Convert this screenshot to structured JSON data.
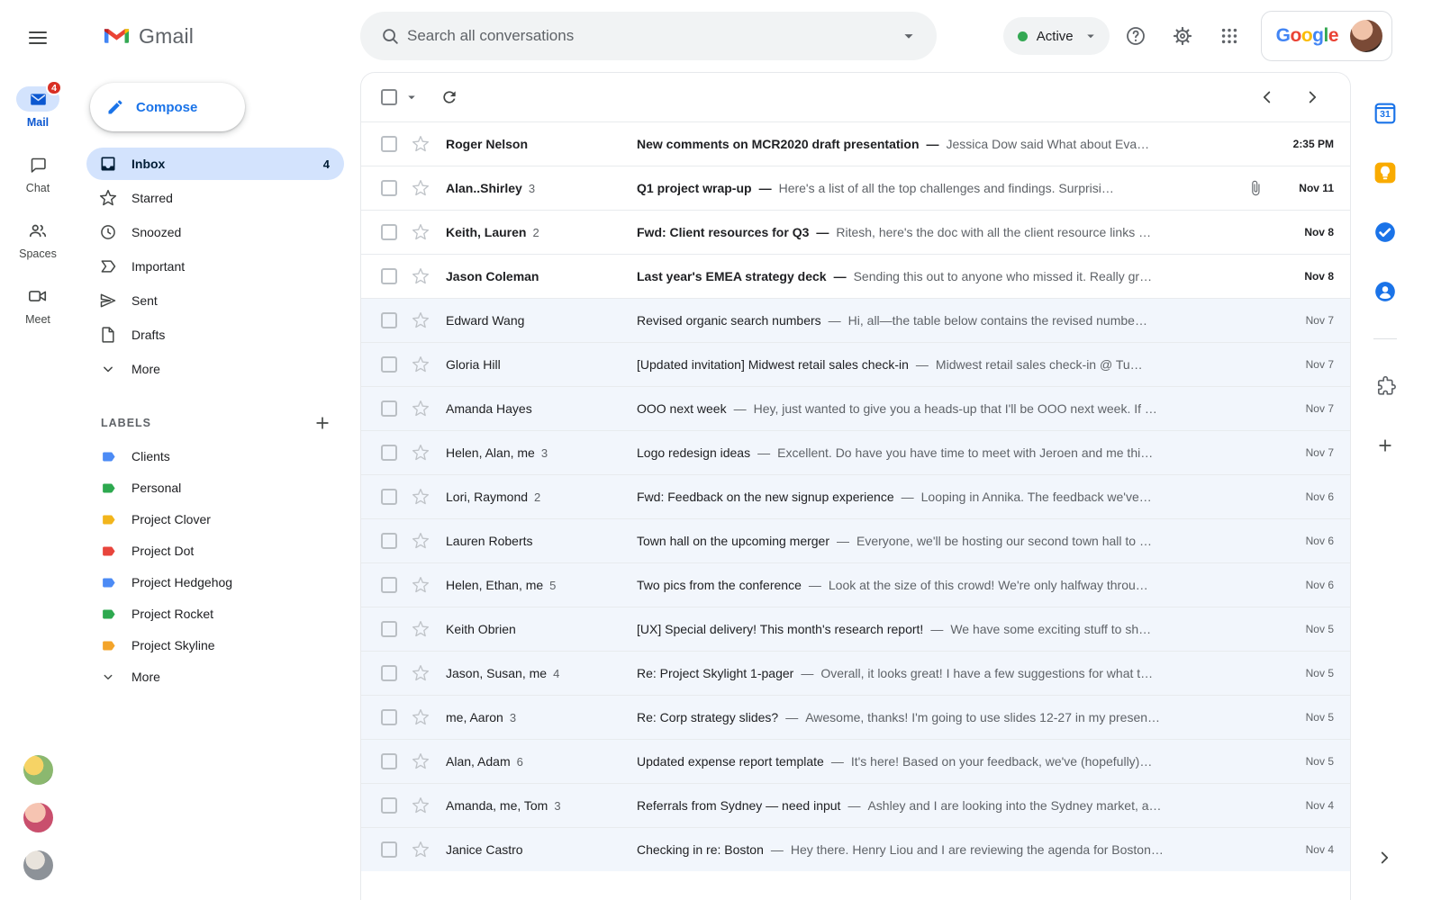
{
  "brand": {
    "name": "Gmail"
  },
  "colors": {
    "accent_blue": "#0b57d0",
    "selection_blue": "#d3e3fd",
    "status_green": "#34a853",
    "badge_red": "#d93025"
  },
  "left_rail": {
    "items": [
      {
        "label": "Mail",
        "icon": "mail",
        "badge": "4",
        "active": true
      },
      {
        "label": "Chat",
        "icon": "chat",
        "active": false
      },
      {
        "label": "Spaces",
        "icon": "spaces",
        "active": false
      },
      {
        "label": "Meet",
        "icon": "meet",
        "active": false
      }
    ],
    "avatars": [
      "workspace-avatar-1",
      "workspace-avatar-2",
      "workspace-avatar-3"
    ]
  },
  "header": {
    "search_placeholder": "Search all conversations",
    "status_label": "Active",
    "status_color": "#34a853",
    "google_letters": [
      {
        "ch": "G",
        "color": "#4285F4"
      },
      {
        "ch": "o",
        "color": "#EA4335"
      },
      {
        "ch": "o",
        "color": "#FBBC05"
      },
      {
        "ch": "g",
        "color": "#4285F4"
      },
      {
        "ch": "l",
        "color": "#34A853"
      },
      {
        "ch": "e",
        "color": "#EA4335"
      }
    ]
  },
  "sidebar": {
    "compose_label": "Compose",
    "items": [
      {
        "label": "Inbox",
        "icon": "inbox",
        "count": "4",
        "active": true
      },
      {
        "label": "Starred",
        "icon": "star-nav"
      },
      {
        "label": "Snoozed",
        "icon": "clock"
      },
      {
        "label": "Important",
        "icon": "important"
      },
      {
        "label": "Sent",
        "icon": "sent"
      },
      {
        "label": "Drafts",
        "icon": "draft"
      },
      {
        "label": "More",
        "icon": "chevron-down"
      }
    ],
    "labels_title": "LABELS",
    "labels": [
      {
        "label": "Clients",
        "color": "#4c8bf5"
      },
      {
        "label": "Personal",
        "color": "#2da94f"
      },
      {
        "label": "Project Clover",
        "color": "#f2b51c"
      },
      {
        "label": "Project Dot",
        "color": "#e8453c"
      },
      {
        "label": "Project Hedgehog",
        "color": "#4c8bf5"
      },
      {
        "label": "Project Rocket",
        "color": "#2da94f"
      },
      {
        "label": "Project Skyline",
        "color": "#f3a42a"
      },
      {
        "label": "More",
        "icon": "chevron-down"
      }
    ]
  },
  "list": {
    "separator": "—"
  },
  "emails": [
    {
      "sender": "Roger Nelson",
      "subject": "New comments on MCR2020 draft presentation",
      "snippet": "Jessica Dow said What about Eva…",
      "date": "2:35 PM",
      "unread": true
    },
    {
      "sender": "Alan..Shirley",
      "count": "3",
      "subject": "Q1 project wrap-up",
      "snippet": "Here's a list of all the top challenges and findings. Surprisi…",
      "date": "Nov 11",
      "unread": true,
      "attachment": true
    },
    {
      "sender": "Keith, Lauren",
      "count": "2",
      "subject": "Fwd: Client resources for Q3",
      "snippet": "Ritesh, here's the doc with all the client resource links …",
      "date": "Nov 8",
      "unread": true
    },
    {
      "sender": "Jason Coleman",
      "subject": "Last year's EMEA strategy deck",
      "snippet": "Sending this out to anyone who missed it. Really gr…",
      "date": "Nov 8",
      "unread": true
    },
    {
      "sender": "Edward Wang",
      "subject": "Revised organic search numbers",
      "snippet": "Hi, all—the table below contains the revised numbe…",
      "date": "Nov 7",
      "unread": false
    },
    {
      "sender": "Gloria Hill",
      "subject": "[Updated invitation] Midwest retail sales check-in",
      "snippet": "Midwest retail sales check-in @ Tu…",
      "date": "Nov 7",
      "unread": false
    },
    {
      "sender": "Amanda Hayes",
      "subject": "OOO next week",
      "snippet": "Hey, just wanted to give you a heads-up that I'll be OOO next week. If …",
      "date": "Nov 7",
      "unread": false
    },
    {
      "sender": "Helen, Alan, me",
      "count": "3",
      "subject": "Logo redesign ideas",
      "snippet": "Excellent. Do have you have time to meet with Jeroen and me thi…",
      "date": "Nov 7",
      "unread": false
    },
    {
      "sender": "Lori, Raymond",
      "count": "2",
      "subject": "Fwd: Feedback on the new signup experience",
      "snippet": "Looping in Annika. The feedback we've…",
      "date": "Nov 6",
      "unread": false
    },
    {
      "sender": "Lauren Roberts",
      "subject": "Town hall on the upcoming merger",
      "snippet": "Everyone, we'll be hosting our second town hall to …",
      "date": "Nov 6",
      "unread": false
    },
    {
      "sender": "Helen, Ethan, me",
      "count": "5",
      "subject": "Two pics from the conference",
      "snippet": "Look at the size of this crowd! We're only halfway throu…",
      "date": "Nov 6",
      "unread": false
    },
    {
      "sender": "Keith Obrien",
      "subject": "[UX] Special delivery! This month's research report!",
      "snippet": "We have some exciting stuff to sh…",
      "date": "Nov 5",
      "unread": false
    },
    {
      "sender": "Jason, Susan, me",
      "count": "4",
      "subject": "Re: Project Skylight 1-pager",
      "snippet": "Overall, it looks great! I have a few suggestions for what t…",
      "date": "Nov 5",
      "unread": false
    },
    {
      "sender": "me, Aaron",
      "count": "3",
      "subject": "Re: Corp strategy slides?",
      "snippet": "Awesome, thanks! I'm going to use slides 12-27 in my presen…",
      "date": "Nov 5",
      "unread": false
    },
    {
      "sender": "Alan, Adam",
      "count": "6",
      "subject": "Updated expense report template",
      "snippet": "It's here! Based on your feedback, we've (hopefully)…",
      "date": "Nov 5",
      "unread": false
    },
    {
      "sender": "Amanda, me, Tom",
      "count": "3",
      "subject": "Referrals from Sydney — need input",
      "snippet": "Ashley and I are looking into the Sydney market, a…",
      "date": "Nov 4",
      "unread": false
    },
    {
      "sender": "Janice Castro",
      "subject": "Checking in re: Boston",
      "snippet": "Hey there. Henry Liou and I are reviewing the agenda for Boston…",
      "date": "Nov 4",
      "unread": false
    }
  ],
  "right_rail": {
    "items": [
      {
        "name": "calendar",
        "icon": "calendar",
        "label": "31"
      },
      {
        "name": "keep",
        "icon": "keep"
      },
      {
        "name": "tasks",
        "icon": "tasks"
      },
      {
        "name": "contacts",
        "icon": "contacts"
      },
      {
        "type": "divider"
      },
      {
        "name": "extensions",
        "icon": "extension"
      },
      {
        "name": "get-add-ons",
        "icon": "plus"
      }
    ]
  }
}
